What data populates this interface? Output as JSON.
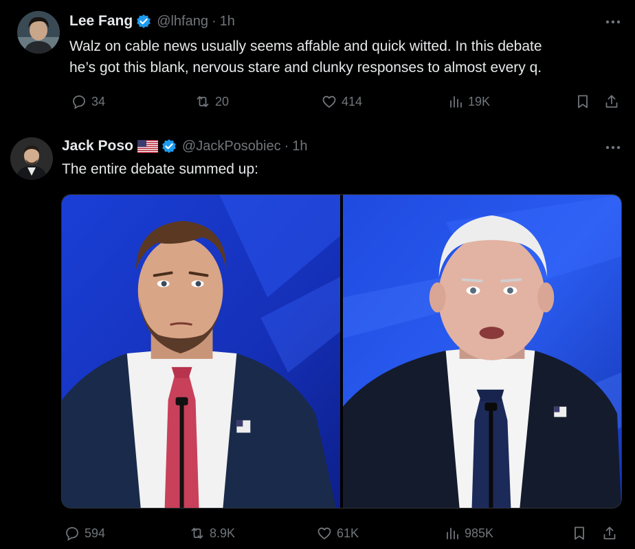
{
  "tweets": [
    {
      "name": "Lee Fang",
      "handle": "@lhfang",
      "separator": "·",
      "time": "1h",
      "text_lines": [
        "Walz on cable news usually seems affable and quick witted. In this debate",
        "he’s got this blank, nervous stare and clunky responses to almost every q."
      ],
      "replies": "34",
      "reposts": "20",
      "likes": "414",
      "views": "19K"
    },
    {
      "name": "Jack Poso",
      "handle": "@JackPosobiec",
      "separator": "·",
      "time": "1h",
      "text_lines": [
        "The entire debate summed up:"
      ],
      "replies": "594",
      "reposts": "8.9K",
      "likes": "61K",
      "views": "985K"
    }
  ],
  "icons": {
    "reply": "reply-icon",
    "repost": "repost-icon",
    "like": "heart-icon",
    "views": "views-icon",
    "bookmark": "bookmark-icon",
    "share": "share-icon",
    "more": "more-icon",
    "verified": "verified-badge-icon",
    "flag": "us-flag-icon"
  },
  "colors": {
    "background": "#000000",
    "text": "#e7e9ea",
    "muted": "#71767b",
    "verified": "#1d9bf0"
  }
}
